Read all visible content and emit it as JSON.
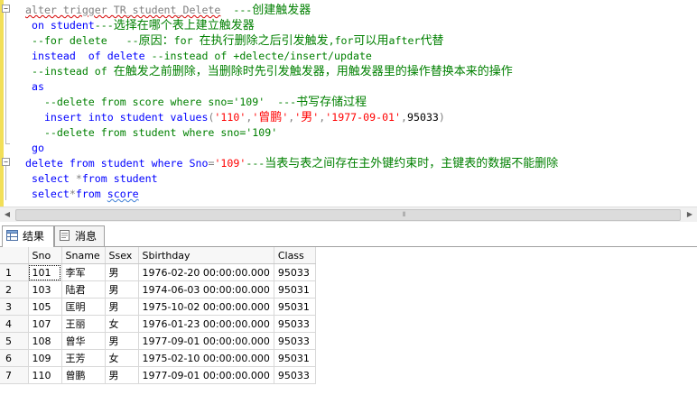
{
  "editor": {
    "lines": [
      {
        "tokens": [
          {
            "t": "alter trigger TR_student_Delete",
            "c": "gray sq"
          },
          {
            "t": "  ---",
            "c": "cm"
          },
          {
            "t": "创建触发器",
            "c": "cm cjk"
          }
        ]
      },
      {
        "tokens": [
          {
            "t": " on ",
            "c": "kw"
          },
          {
            "t": "student",
            "c": "kw"
          },
          {
            "t": "---",
            "c": "cm"
          },
          {
            "t": "选择在哪个表上建立触发器",
            "c": "cm cjk"
          }
        ]
      },
      {
        "tokens": [
          {
            "t": " --for delete   --",
            "c": "cm"
          },
          {
            "t": "原因：",
            "c": "cm cjk"
          },
          {
            "t": "for ",
            "c": "cm"
          },
          {
            "t": "在执行删除之后引发触发",
            "c": "cm cjk"
          },
          {
            "t": ",for",
            "c": "cm"
          },
          {
            "t": "可以用",
            "c": "cm cjk"
          },
          {
            "t": "after",
            "c": "cm"
          },
          {
            "t": "代替",
            "c": "cm cjk"
          }
        ]
      },
      {
        "tokens": [
          {
            "t": " instead  of delete ",
            "c": "kw"
          },
          {
            "t": "--instead of +delecte/insert/update",
            "c": "cm"
          }
        ]
      },
      {
        "tokens": [
          {
            "t": " --instead of ",
            "c": "cm"
          },
          {
            "t": "在触发之前删除，当删除时先引发触发器，用触发器里的操作替换本来的操作",
            "c": "cm cjk"
          }
        ]
      },
      {
        "tokens": [
          {
            "t": " as",
            "c": "kw"
          }
        ]
      },
      {
        "tokens": [
          {
            "t": "   --delete from score where sno='109'  ---",
            "c": "cm"
          },
          {
            "t": "书写存储过程",
            "c": "cm cjk"
          }
        ]
      },
      {
        "tokens": [
          {
            "t": "   insert into ",
            "c": "kw"
          },
          {
            "t": "student ",
            "c": "kw"
          },
          {
            "t": "values",
            "c": "kw"
          },
          {
            "t": "(",
            "c": "gray"
          },
          {
            "t": "'110'",
            "c": "str"
          },
          {
            "t": ",",
            "c": "gray"
          },
          {
            "t": "'",
            "c": "str"
          },
          {
            "t": "曾鹏",
            "c": "str cjk"
          },
          {
            "t": "'",
            "c": "str"
          },
          {
            "t": ",",
            "c": "gray"
          },
          {
            "t": "'",
            "c": "str"
          },
          {
            "t": "男",
            "c": "str cjk"
          },
          {
            "t": "'",
            "c": "str"
          },
          {
            "t": ",",
            "c": "gray"
          },
          {
            "t": "'1977-09-01'",
            "c": "str"
          },
          {
            "t": ",",
            "c": "gray"
          },
          {
            "t": "95033",
            "c": "plain"
          },
          {
            "t": ")",
            "c": "gray"
          }
        ]
      },
      {
        "tokens": [
          {
            "t": "   --delete from student where sno='109'",
            "c": "cm"
          }
        ]
      },
      {
        "tokens": [
          {
            "t": " go",
            "c": "kw"
          }
        ]
      },
      {
        "tokens": [
          {
            "t": "delete from ",
            "c": "kw"
          },
          {
            "t": "student ",
            "c": "kw"
          },
          {
            "t": "where ",
            "c": "kw"
          },
          {
            "t": "Sno",
            "c": "kw"
          },
          {
            "t": "=",
            "c": "gray"
          },
          {
            "t": "'109'",
            "c": "str"
          },
          {
            "t": "---",
            "c": "cm"
          },
          {
            "t": "当表与表之间存在主外键约束时，主键表的数据不能删除",
            "c": "cm cjk"
          }
        ]
      },
      {
        "tokens": [
          {
            "t": " select ",
            "c": "kw"
          },
          {
            "t": "*",
            "c": "gray"
          },
          {
            "t": "from ",
            "c": "kw"
          },
          {
            "t": "student",
            "c": "kw"
          }
        ]
      },
      {
        "tokens": [
          {
            "t": " select",
            "c": "kw"
          },
          {
            "t": "*",
            "c": "gray"
          },
          {
            "t": "from ",
            "c": "kw"
          },
          {
            "t": "score",
            "c": "kw sq-blue"
          }
        ]
      }
    ]
  },
  "tabs": [
    {
      "label": "结果",
      "icon": "results-grid-icon",
      "active": true
    },
    {
      "label": "消息",
      "icon": "messages-icon",
      "active": false
    }
  ],
  "results": {
    "columns": [
      "Sno",
      "Sname",
      "Ssex",
      "Sbirthday",
      "Class"
    ],
    "rows": [
      {
        "n": "1",
        "cells": [
          "101",
          "李军",
          "男",
          "1976-02-20 00:00:00.000",
          "95033"
        ]
      },
      {
        "n": "2",
        "cells": [
          "103",
          "陆君",
          "男",
          "1974-06-03 00:00:00.000",
          "95031"
        ]
      },
      {
        "n": "3",
        "cells": [
          "105",
          "匡明",
          "男",
          "1975-10-02 00:00:00.000",
          "95031"
        ]
      },
      {
        "n": "4",
        "cells": [
          "107",
          "王丽",
          "女",
          "1976-01-23 00:00:00.000",
          "95033"
        ]
      },
      {
        "n": "5",
        "cells": [
          "108",
          "曾华",
          "男",
          "1977-09-01 00:00:00.000",
          "95033"
        ]
      },
      {
        "n": "6",
        "cells": [
          "109",
          "王芳",
          "女",
          "1975-02-10 00:00:00.000",
          "95031"
        ]
      },
      {
        "n": "7",
        "cells": [
          "110",
          "曾鹏",
          "男",
          "1977-09-01 00:00:00.000",
          "95033"
        ]
      }
    ]
  },
  "scrollbar": {
    "grip": "⦀"
  }
}
